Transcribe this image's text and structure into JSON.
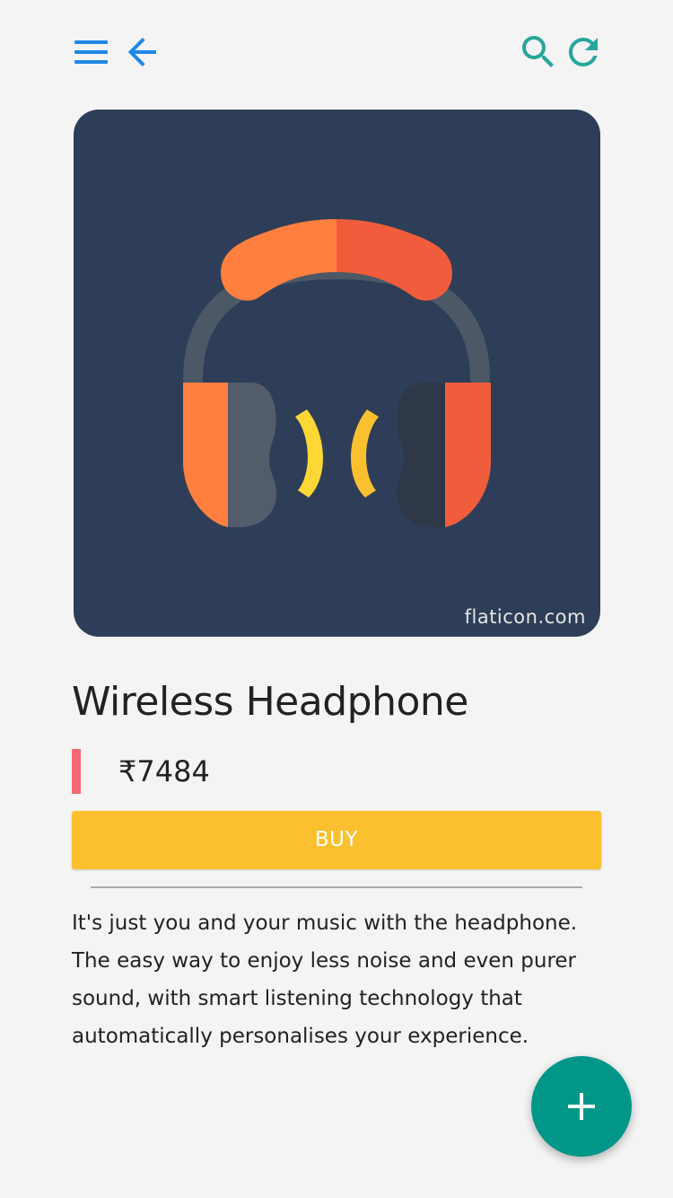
{
  "header": {
    "menu_icon": "hamburger-menu-icon",
    "back_icon": "arrow-back-icon",
    "search_icon": "search-icon",
    "refresh_icon": "refresh-icon",
    "left_icon_color": "#1e88e5",
    "right_icon_color": "#26a69a"
  },
  "product": {
    "image_icon": "headphones-icon",
    "image_background": "#2e3e58",
    "watermark": "flaticon.com",
    "title": "Wireless Headphone",
    "price": "₹7484",
    "price_accent_color": "#ef6b73",
    "buy_label": "BUY",
    "buy_color": "#fbc02d",
    "description": "It's just you and your music with the headphone. The easy way to enjoy less noise and even purer sound, with smart listening technology that automatically personalises your experience."
  },
  "fab": {
    "icon": "plus-icon",
    "color": "#009688"
  }
}
